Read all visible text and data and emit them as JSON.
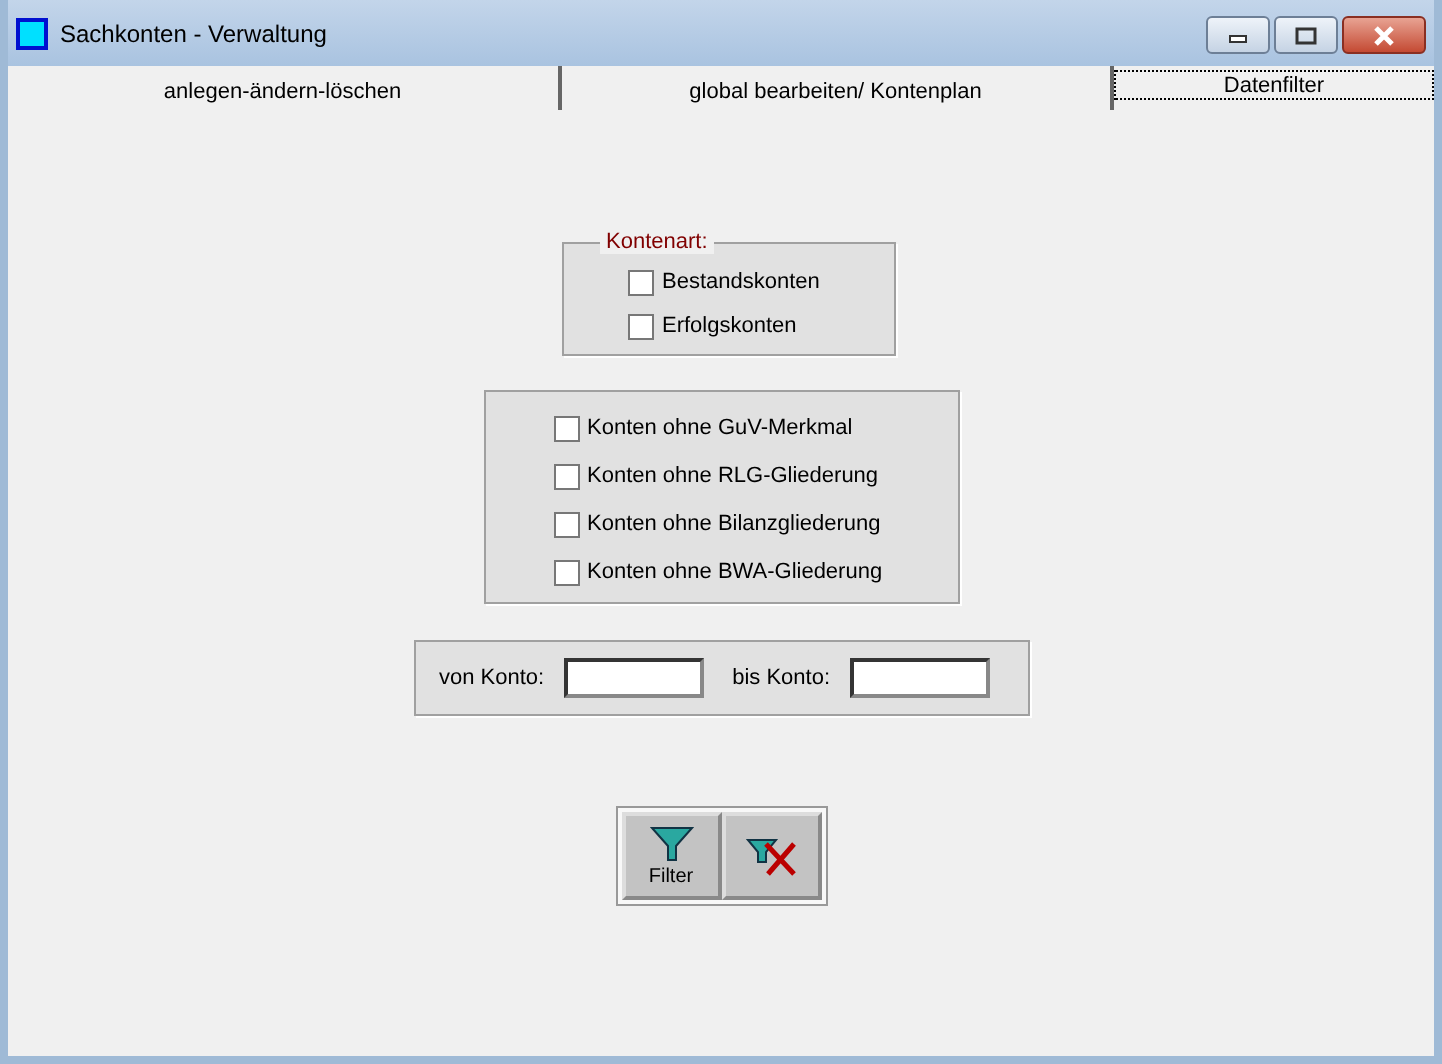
{
  "window": {
    "title": "Sachkonten - Verwaltung"
  },
  "tabs": [
    {
      "label": "anlegen-ändern-löschen",
      "selected": false
    },
    {
      "label": "global bearbeiten/ Kontenplan",
      "selected": false
    },
    {
      "label": "Datenfilter",
      "selected": true
    }
  ],
  "kontenart": {
    "legend": "Kontenart:",
    "options": [
      {
        "label": "Bestandskonten",
        "checked": false
      },
      {
        "label": "Erfolgskonten",
        "checked": false
      }
    ]
  },
  "filters": [
    {
      "label": "Konten ohne GuV-Merkmal",
      "checked": false
    },
    {
      "label": "Konten ohne RLG-Gliederung",
      "checked": false
    },
    {
      "label": "Konten ohne Bilanzgliederung",
      "checked": false
    },
    {
      "label": "Konten ohne BWA-Gliederung",
      "checked": false
    }
  ],
  "range": {
    "from_label": "von Konto:",
    "to_label": "bis Konto:"
  },
  "buttons": [
    {
      "kind": "filter",
      "label": "Filter"
    },
    {
      "kind": "clear"
    }
  ]
}
